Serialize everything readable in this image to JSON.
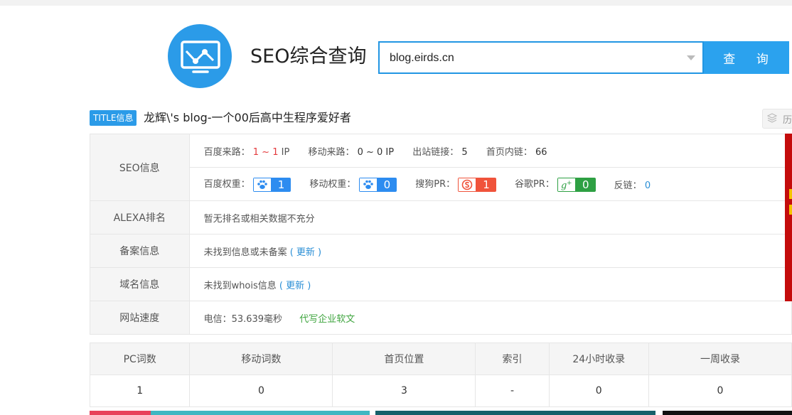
{
  "header": {
    "title": "SEO综合查询"
  },
  "search": {
    "value": "blog.eirds.cn",
    "button_label": "查 询"
  },
  "title_info": {
    "badge": "TITLE信息",
    "text": "龙辉\\'s blog-一个00后高中生程序爱好者",
    "history_label": "历"
  },
  "seo": {
    "label": "SEO信息",
    "baidu_traffic_label": "百度来路：",
    "baidu_traffic_from": "1",
    "baidu_traffic_sep": "~",
    "baidu_traffic_to": "1",
    "baidu_traffic_unit": "IP",
    "mobile_traffic_label": "移动来路：",
    "mobile_traffic_value": "0 ~ 0 IP",
    "outbound_label": "出站链接：",
    "outbound_value": "5",
    "inbound_label": "首页内链：",
    "inbound_value": "66",
    "baidu_weight_label": "百度权重：",
    "baidu_weight_value": "1",
    "mobile_weight_label": "移动权重：",
    "mobile_weight_value": "0",
    "sogou_label": "搜狗PR：",
    "sogou_value": "1",
    "google_label": "谷歌PR：",
    "google_value": "0",
    "backlink_label": "反链：",
    "backlink_value": "0"
  },
  "alexa": {
    "label": "ALEXA排名",
    "value": "暂无排名或相关数据不充分"
  },
  "icp": {
    "label": "备案信息",
    "value": "未找到信息或未备案",
    "update_label": "( 更新 )"
  },
  "whois": {
    "label": "域名信息",
    "value": "未找到whois信息",
    "update_label": "( 更新 )"
  },
  "speed": {
    "label": "网站速度",
    "value": "电信：53.639毫秒",
    "ad_link": "代写企业软文"
  },
  "stats": {
    "headers": [
      "PC词数",
      "移动词数",
      "首页位置",
      "索引",
      "24小时收录",
      "一周收录"
    ],
    "values": [
      "1",
      "0",
      "3",
      "-",
      "0",
      "0"
    ]
  },
  "colors": {
    "accent": "#2b9be8",
    "red": "#e4393c",
    "green": "#3fa53f",
    "link": "#2b8fd6"
  }
}
